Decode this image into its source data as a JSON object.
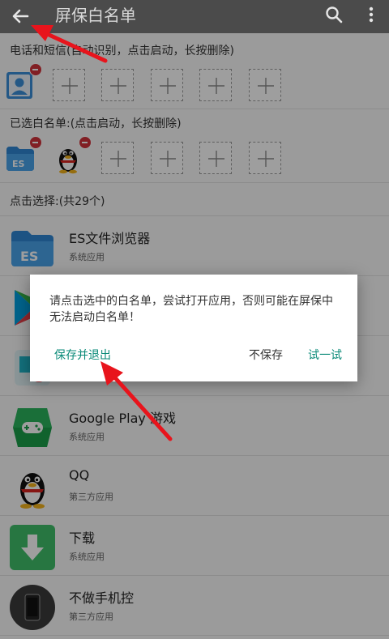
{
  "toolbar": {
    "title": "屏保白名单",
    "back_icon": "arrow-left-icon",
    "search_icon": "search-icon",
    "more_icon": "more-vert-icon"
  },
  "section_phone": {
    "label": "电话和短信(自动识别，点击启动，长按删除)"
  },
  "section_selected": {
    "label": "已选白名单:(点击启动，长按删除)"
  },
  "section_choose": {
    "label": "点击选择:(共29个)"
  },
  "apps": [
    {
      "name": "ES文件浏览器",
      "type": "系统应用",
      "icon": "es-file-explorer-icon"
    },
    {
      "name": "",
      "type": "",
      "icon": "play-store-icon"
    },
    {
      "name": "",
      "type": "",
      "icon": "photos-icon"
    },
    {
      "name": "Google Play 游戏",
      "type": "系统应用",
      "icon": "play-games-icon"
    },
    {
      "name": "QQ",
      "type": "第三方应用",
      "icon": "qq-penguin-icon"
    },
    {
      "name": "下载",
      "type": "系统应用",
      "icon": "download-icon"
    },
    {
      "name": "不做手机控",
      "type": "第三方应用",
      "icon": "phone-icon"
    }
  ],
  "dialog": {
    "message": "请点击选中的白名单，尝试打开应用，否则可能在屏保中无法启动白名单！",
    "save_exit": "保存并退出",
    "no_save": "不保存",
    "try": "试一试"
  },
  "colors": {
    "toolbar": "#4b4b4b",
    "accent": "#0a8a78",
    "badge": "#d0323a",
    "annotation_arrow": "#e8141c"
  }
}
